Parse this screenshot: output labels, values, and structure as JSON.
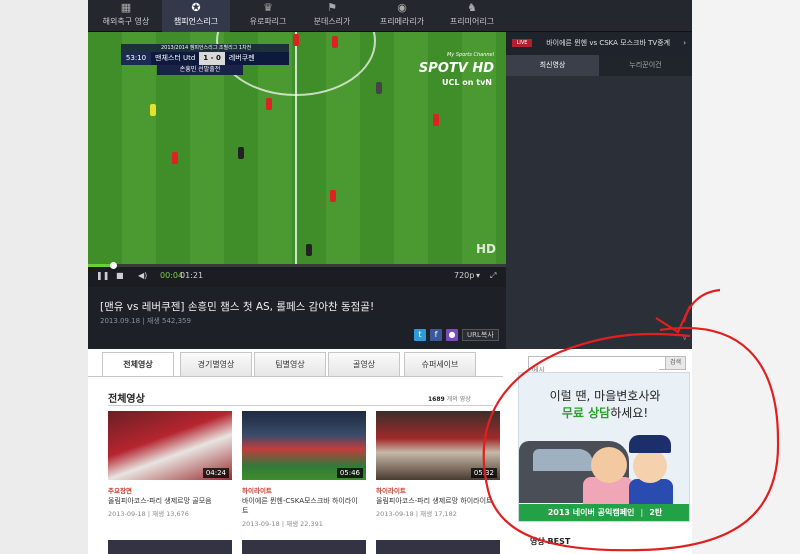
{
  "nav": {
    "items": [
      {
        "label": "해외축구 영상",
        "icon": "grid-icon"
      },
      {
        "label": "챔피언스리그",
        "icon": "ucl-icon",
        "active": true
      },
      {
        "label": "유로파리그",
        "icon": "europa-icon"
      },
      {
        "label": "분데스리가",
        "icon": "bundesliga-icon"
      },
      {
        "label": "프리메라리가",
        "icon": "laliga-icon"
      },
      {
        "label": "프리미어리그",
        "icon": "epl-icon"
      }
    ]
  },
  "player": {
    "scorebug": {
      "header": "2013/2014 챔피언스리그 조별리그 1차전",
      "time": "53:10",
      "home": "맨체스터 Utd",
      "score": "1 - 0",
      "away": "레버쿠젠",
      "sub": "손흥민 선발출전"
    },
    "channel_tagline": "My Sports Channel",
    "channel": "SPOTV HD",
    "broadcaster": "UCL on tvN",
    "hd": "HD",
    "progress": 0.06,
    "current_time": "00:04",
    "total_time": "01:21",
    "quality": "720p"
  },
  "video": {
    "title": "[맨유 vs 레버쿠젠] 손흥민 챔스 첫 AS, 롤페스 감아찬 동점골!",
    "meta": "2013.09.18 | 재생 542,359",
    "url_copy": "URL복사"
  },
  "side": {
    "live_badge": "LIVE",
    "banner": "바이에른 뮌헨 vs CSKA 모스크바 TV중계",
    "tabs": [
      "최신영상",
      "누리꾼이건"
    ]
  },
  "category_tabs": [
    "전체영상",
    "경기별영상",
    "팀별영상",
    "골영상",
    "슈퍼세이브"
  ],
  "search": {
    "placeholder": "에시",
    "button": "검색"
  },
  "section": {
    "title": "전체영상",
    "count_number": "1689",
    "count_suffix": "개의 영상"
  },
  "cards": [
    {
      "duration": "04:24",
      "category": "주요장면",
      "title": "올림피아코스-파리 생제르망 골모음",
      "meta": "2013-09-18 | 재생 13,676"
    },
    {
      "duration": "05:46",
      "category": "하이라이트",
      "title": "바이에른 뮌헨-CSKA모스크바 하이라이트",
      "meta": "2013-09-18 | 재생 22,391"
    },
    {
      "duration": "05:32",
      "category": "하이라이트",
      "title": "올림피아코스-파리 생제르망 하이라이트",
      "meta": "2013-09-18 | 재생 17,182"
    }
  ],
  "ad": {
    "line1": "이럴 땐, 마을변호사와",
    "line2_hl": "무료 상담",
    "line2_rest": "하세요!",
    "footer_left": "2013 네이버 공익캠페인",
    "footer_right": "2탄"
  },
  "best_title": "영상 BEST",
  "colors": {
    "accent_green": "#6ccf3a",
    "annotation_red": "#e02020",
    "nav_bg": "#24272e"
  }
}
